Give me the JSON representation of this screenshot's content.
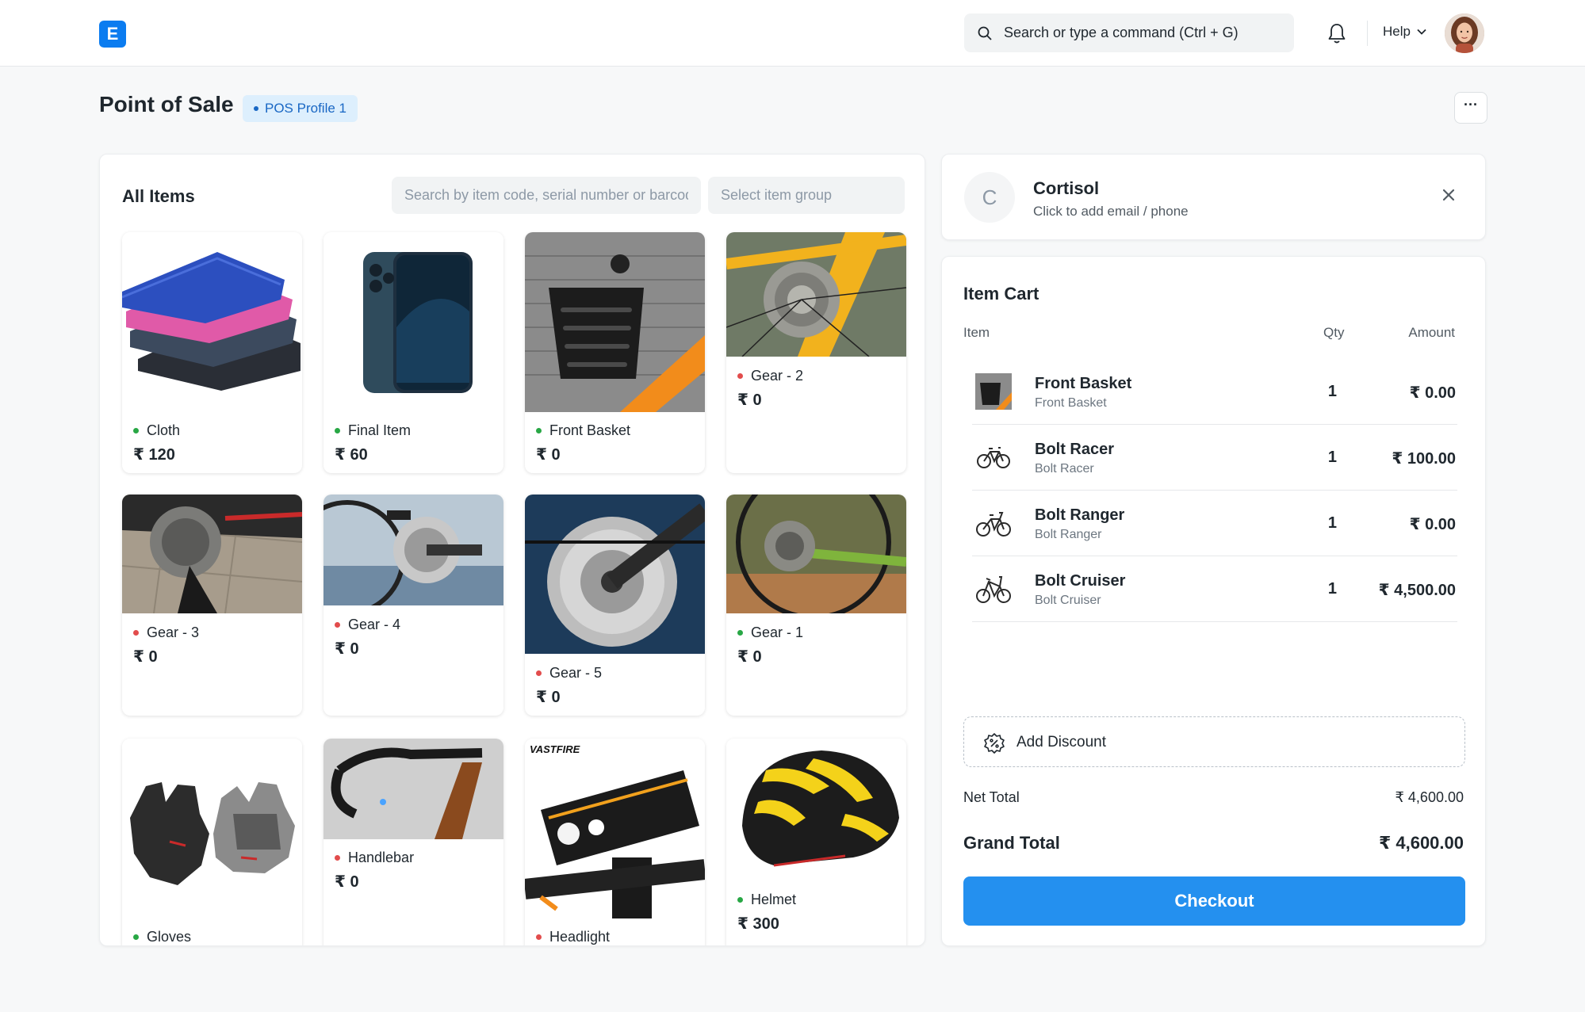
{
  "navbar": {
    "logo_letter": "E",
    "search_placeholder": "Search or type a command (Ctrl + G)",
    "help_label": "Help"
  },
  "page": {
    "title": "Point of Sale",
    "profile_badge": "POS Profile 1",
    "more_label": "···"
  },
  "items_panel": {
    "title": "All Items",
    "search_placeholder": "Search by item code, serial number or barcode",
    "group_placeholder": "Select item group",
    "items": [
      {
        "name": "Cloth",
        "price": "₹ 120",
        "status": "green"
      },
      {
        "name": "Final Item",
        "price": "₹ 60",
        "status": "green"
      },
      {
        "name": "Front Basket",
        "price": "₹ 0",
        "status": "green"
      },
      {
        "name": "Gear - 2",
        "price": "₹ 0",
        "status": "red"
      },
      {
        "name": "Gear - 3",
        "price": "₹ 0",
        "status": "red"
      },
      {
        "name": "Gear - 4",
        "price": "₹ 0",
        "status": "red"
      },
      {
        "name": "Gear - 5",
        "price": "₹ 0",
        "status": "red"
      },
      {
        "name": "Gear - 1",
        "price": "₹ 0",
        "status": "green"
      },
      {
        "name": "Gloves",
        "price": "",
        "status": "green"
      },
      {
        "name": "Handlebar",
        "price": "₹ 0",
        "status": "red"
      },
      {
        "name": "Headlight",
        "price": "",
        "status": "red"
      },
      {
        "name": "Helmet",
        "price": "₹ 300",
        "status": "green"
      }
    ],
    "headlight_brand": "VASTFIRE"
  },
  "customer": {
    "initial": "C",
    "name": "Cortisol",
    "subtitle": "Click to add email / phone"
  },
  "cart": {
    "title": "Item Cart",
    "col_item": "Item",
    "col_qty": "Qty",
    "col_amount": "Amount",
    "rows": [
      {
        "name": "Front Basket",
        "sub": "Front Basket",
        "qty": "1",
        "amount": "₹ 0.00"
      },
      {
        "name": "Bolt Racer",
        "sub": "Bolt Racer",
        "qty": "1",
        "amount": "₹ 100.00"
      },
      {
        "name": "Bolt Ranger",
        "sub": "Bolt Ranger",
        "qty": "1",
        "amount": "₹ 0.00"
      },
      {
        "name": "Bolt Cruiser",
        "sub": "Bolt Cruiser",
        "qty": "1",
        "amount": "₹ 4,500.00"
      }
    ],
    "discount_label": "Add Discount",
    "net_total_label": "Net Total",
    "net_total_value": "₹ 4,600.00",
    "grand_total_label": "Grand Total",
    "grand_total_value": "₹ 4,600.00",
    "checkout_label": "Checkout"
  },
  "colors": {
    "primary": "#2490ef",
    "in_stock": "#28a745",
    "out_of_stock": "#e24c4c",
    "badge_bg": "#ddeffd",
    "badge_text": "#1967c4"
  }
}
